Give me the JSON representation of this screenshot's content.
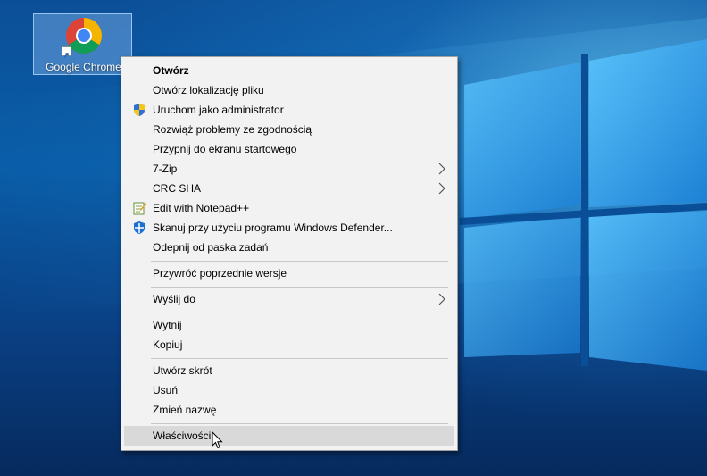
{
  "desktop": {
    "shortcut": {
      "label": "Google Chrome",
      "icon": "chrome-icon"
    }
  },
  "context_menu": {
    "items": [
      {
        "label": "Otwórz",
        "bold": true
      },
      {
        "label": "Otwórz lokalizację pliku"
      },
      {
        "label": "Uruchom jako administrator",
        "icon": "uac-shield-icon"
      },
      {
        "label": "Rozwiąż problemy ze zgodnością"
      },
      {
        "label": "Przypnij do ekranu startowego"
      },
      {
        "label": "7-Zip",
        "submenu": true
      },
      {
        "label": "CRC SHA",
        "submenu": true
      },
      {
        "label": "Edit with Notepad++",
        "icon": "notepadpp-icon"
      },
      {
        "label": "Skanuj przy użyciu programu Windows Defender...",
        "icon": "windows-defender-icon"
      },
      {
        "label": "Odepnij od paska zadań"
      },
      {
        "label": "Przywróć poprzednie wersje"
      },
      {
        "label": "Wyślij do",
        "submenu": true
      },
      {
        "label": "Wytnij"
      },
      {
        "label": "Kopiuj"
      },
      {
        "label": "Utwórz skrót"
      },
      {
        "label": "Usuń"
      },
      {
        "label": "Zmień nazwę"
      },
      {
        "label": "Właściwości",
        "highlighted": true
      }
    ]
  },
  "colors": {
    "menu_bg": "#f2f2f2",
    "highlight": "#d9d9d9",
    "desktop_blue": "#0a5ea9"
  }
}
